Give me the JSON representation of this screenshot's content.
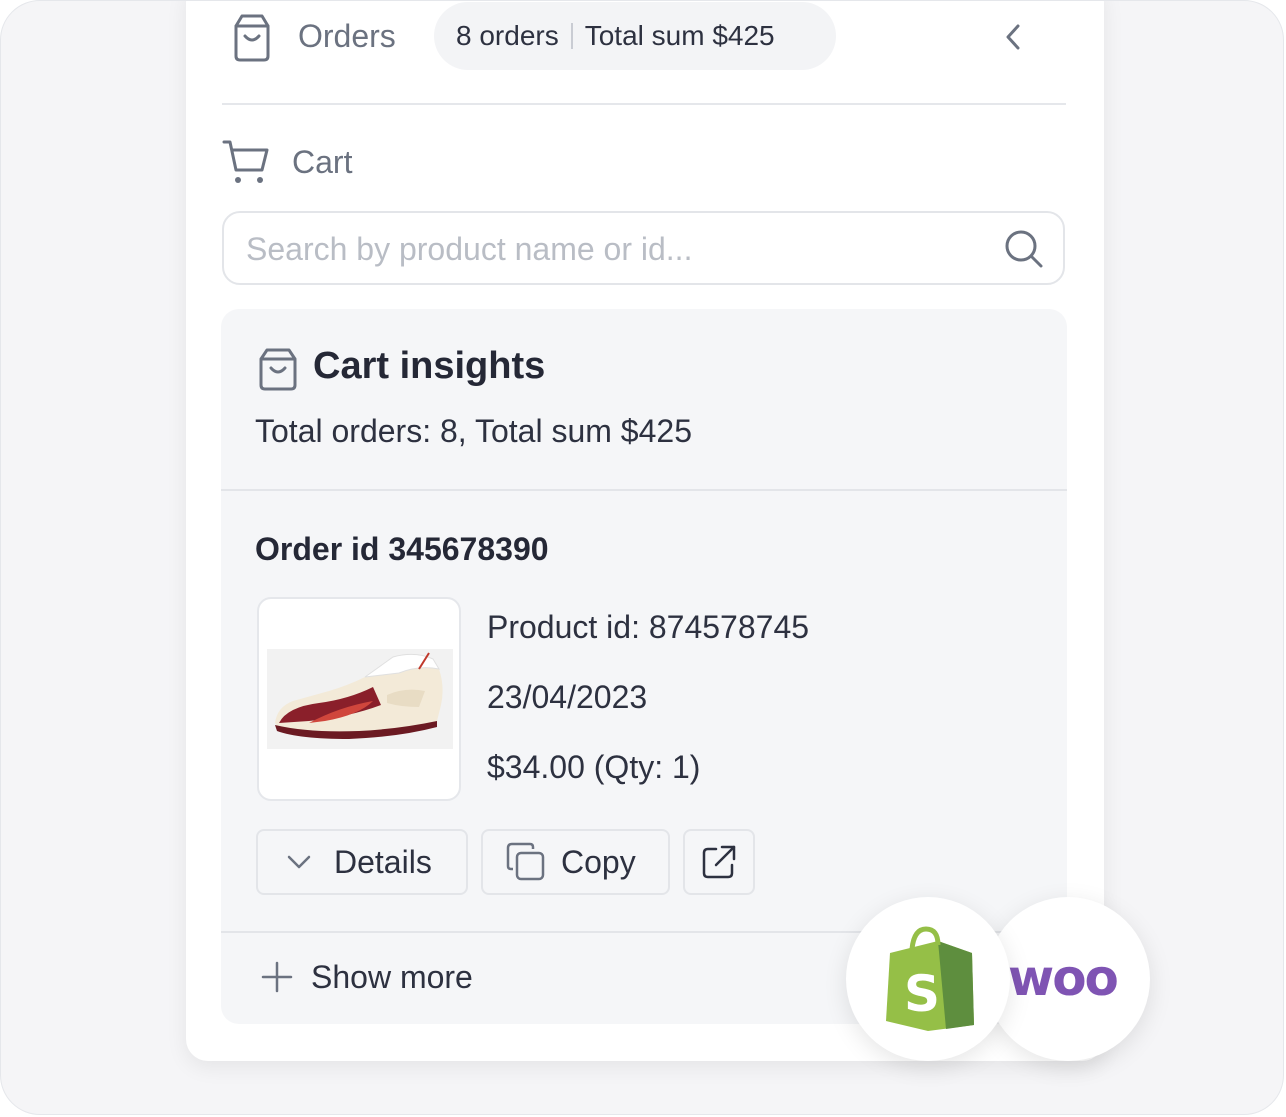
{
  "orders": {
    "title": "Orders",
    "count_text": "8 orders",
    "total_text": "Total sum $425"
  },
  "cart": {
    "title": "Cart"
  },
  "search": {
    "placeholder": "Search by product name or id..."
  },
  "insights": {
    "title": "Cart insights",
    "summary": "Total orders: 8, Total sum $425"
  },
  "order": {
    "id_text": "Order id 345678390",
    "product_id_text": "Product id: 874578745",
    "date": "23/04/2023",
    "price_qty": "$34.00 (Qty: 1)",
    "image_icon": "sneaker-image"
  },
  "actions": {
    "details_label": "Details",
    "copy_label": "Copy"
  },
  "show_more_label": "Show more",
  "integrations": {
    "woo_label": "woo",
    "shopify_icon": "shopify-icon"
  },
  "colors": {
    "shopify_green": "#95bf47",
    "woo_purple": "#7f54b3",
    "text_dark": "#252836",
    "text_muted": "#6b7280"
  }
}
